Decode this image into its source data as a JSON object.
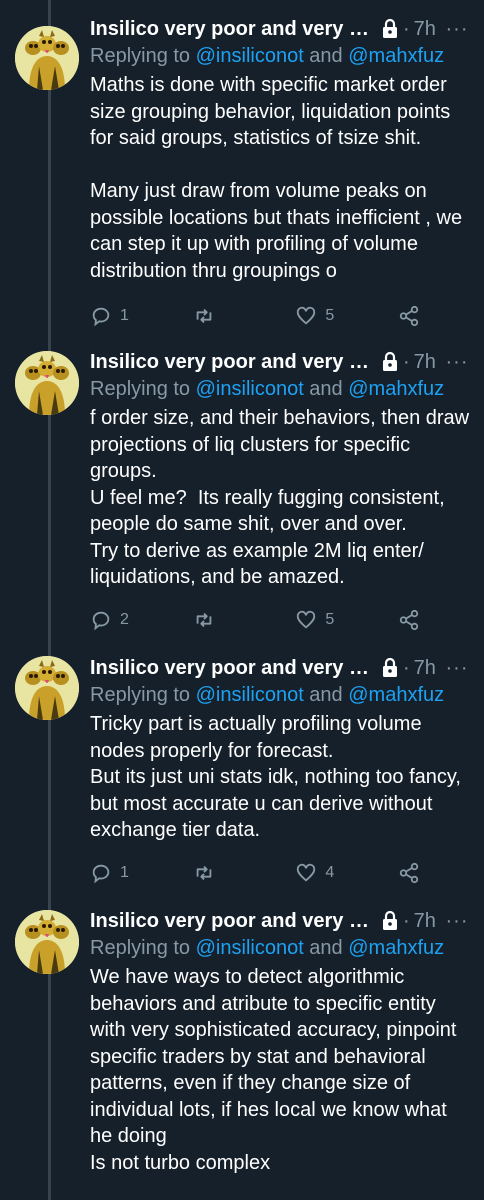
{
  "tweets": [
    {
      "author": "Insilico very poor and very s...",
      "time": "7h",
      "replying_prefix": "Replying to ",
      "mention1": "@insiliconot",
      "and": " and ",
      "mention2": "@mahxfuz",
      "text": "Maths is done with specific market order size grouping behavior, liquidation points for said groups, statistics of tsize shit.\n\nMany just draw from volume peaks on possible locations but thats inefficient , we can step it up with profiling of volume distribution thru groupings o",
      "replies": "1",
      "retweets": "",
      "likes": "5"
    },
    {
      "author": "Insilico very poor and very s...",
      "time": "7h",
      "replying_prefix": "Replying to ",
      "mention1": "@insiliconot",
      "and": " and ",
      "mention2": "@mahxfuz",
      "text": "f order size, and their behaviors, then draw projections of liq clusters for specific groups.\nU feel me?  Its really fugging consistent, people do same shit, over and over.\nTry to derive as example 2M liq enter/ liquidations, and be amazed.",
      "replies": "2",
      "retweets": "",
      "likes": "5"
    },
    {
      "author": "Insilico very poor and very s...",
      "time": "7h",
      "replying_prefix": "Replying to ",
      "mention1": "@insiliconot",
      "and": " and ",
      "mention2": "@mahxfuz",
      "text": "Tricky part is actually profiling volume nodes properly for forecast.\nBut its just uni stats idk, nothing too fancy, but most accurate u can derive without exchange tier data.",
      "replies": "1",
      "retweets": "",
      "likes": "4"
    },
    {
      "author": "Insilico very poor and very s...",
      "time": "7h",
      "replying_prefix": "Replying to ",
      "mention1": "@insiliconot",
      "and": " and ",
      "mention2": "@mahxfuz",
      "text": "We have ways to detect algorithmic behaviors and atribute to specific entity with very sophisticated accuracy, pinpoint specific traders by stat and behavioral patterns, even if they change size of individual lots, if hes local we know what he doing\nIs not turbo complex",
      "replies": "",
      "retweets": "",
      "likes": ""
    }
  ],
  "separator": "·",
  "more_glyph": "···",
  "icons": {
    "reply": "reply-icon",
    "retweet": "retweet-icon",
    "like": "heart-icon",
    "share": "share-icon",
    "lock": "lock-icon",
    "more": "more-icon"
  },
  "colors": {
    "background": "#15202b",
    "secondary_text": "#8899a6",
    "mention": "#1da1f2",
    "thread_line": "#38444d"
  }
}
